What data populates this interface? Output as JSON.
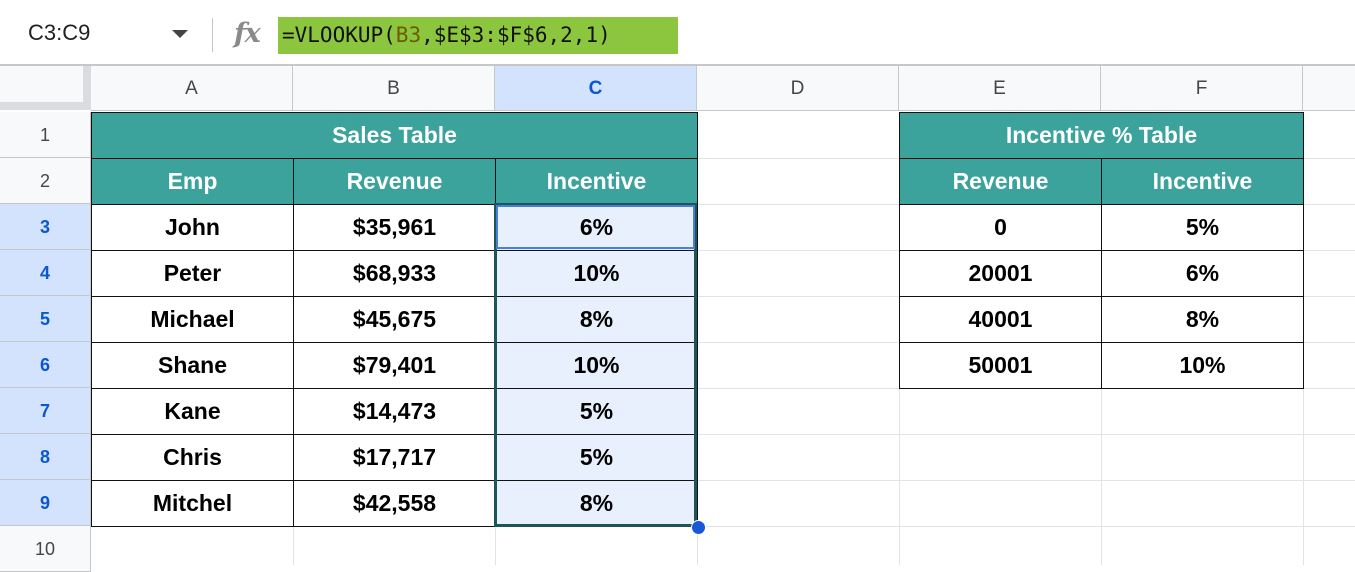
{
  "formula_bar": {
    "name_box": "C3:C9",
    "fx_label": "fx",
    "formula_prefix": "=VLOOKUP(",
    "formula_ref": "B3",
    "formula_suffix": ",$E$3:$F$6,2,1)",
    "formula_highlight_color": "#8cc63f"
  },
  "columns": [
    "A",
    "B",
    "C",
    "D",
    "E",
    "F"
  ],
  "rows": [
    "1",
    "2",
    "3",
    "4",
    "5",
    "6",
    "7",
    "8",
    "9",
    "10"
  ],
  "selected_column": "C",
  "selected_rows": [
    "3",
    "4",
    "5",
    "6",
    "7",
    "8",
    "9"
  ],
  "sales_table": {
    "title": "Sales Table",
    "headers": [
      "Emp",
      "Revenue",
      "Incentive"
    ],
    "rows": [
      [
        "John",
        "$35,961",
        "6%"
      ],
      [
        "Peter",
        "$68,933",
        "10%"
      ],
      [
        "Michael",
        "$45,675",
        "8%"
      ],
      [
        "Shane",
        "$79,401",
        "10%"
      ],
      [
        "Kane",
        "$14,473",
        "5%"
      ],
      [
        "Chris",
        "$17,717",
        "5%"
      ],
      [
        "Mitchel",
        "$42,558",
        "8%"
      ]
    ]
  },
  "incentive_table": {
    "title": "Incentive % Table",
    "headers": [
      "Revenue",
      "Incentive"
    ],
    "rows": [
      [
        "0",
        "5%"
      ],
      [
        "20001",
        "6%"
      ],
      [
        "40001",
        "8%"
      ],
      [
        "50001",
        "10%"
      ]
    ]
  },
  "colors": {
    "table_header_bg": "#3ba29c",
    "selection_bg": "#e8effd",
    "selection_header_bg": "#d3e3fd"
  }
}
